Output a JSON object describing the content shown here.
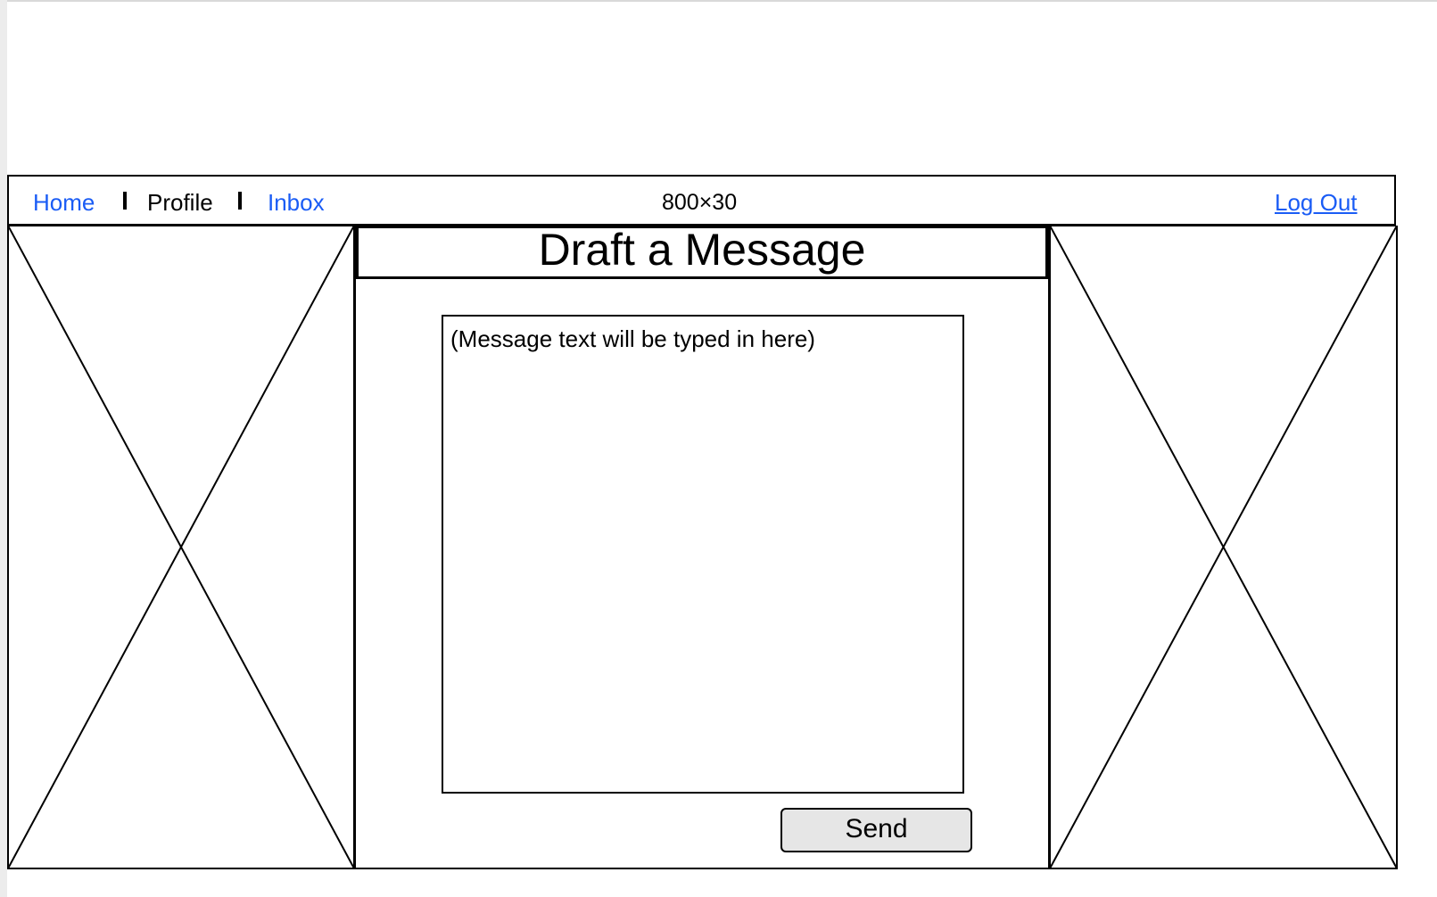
{
  "nav": {
    "home_label": "Home",
    "profile_label": "Profile",
    "inbox_label": "Inbox",
    "logout_label": "Log Out",
    "dimension_label": "800×30"
  },
  "main": {
    "title": "Draft a Message",
    "message_placeholder": "(Message text will be typed in here)",
    "send_label": "Send"
  },
  "colors": {
    "link": "#1a5cf5",
    "border": "#000000",
    "button_bg": "#e6e6e6"
  }
}
